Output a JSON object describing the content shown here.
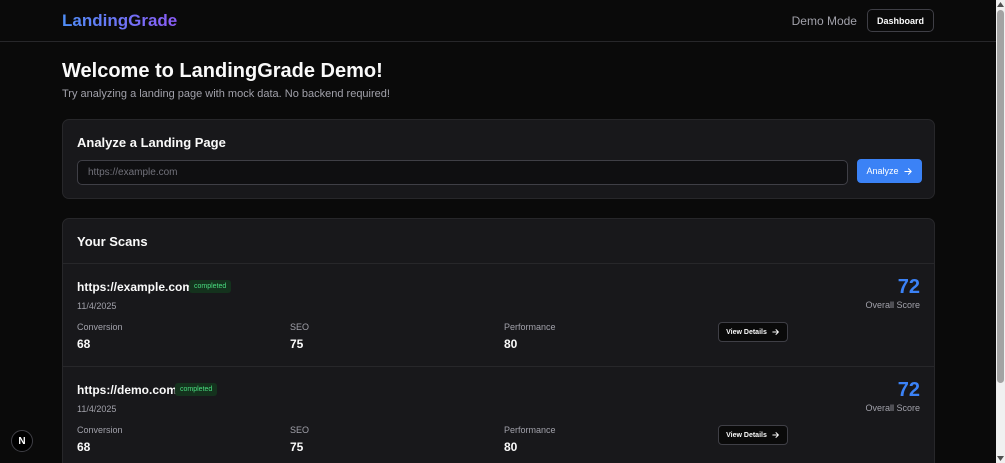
{
  "header": {
    "logo": "LandingGrade",
    "demo_mode": "Demo Mode",
    "dashboard_button": "Dashboard"
  },
  "hero": {
    "title": "Welcome to LandingGrade Demo!",
    "subtitle": "Try analyzing a landing page with mock data. No backend required!"
  },
  "analyze": {
    "title": "Analyze a Landing Page",
    "input_placeholder": "https://example.com",
    "input_value": "",
    "button_label": "Analyze"
  },
  "scans": {
    "title": "Your Scans",
    "items": [
      {
        "url": "https://example.com",
        "status": "completed",
        "date": "11/4/2025",
        "score": "72",
        "score_label": "Overall Score",
        "metrics": [
          {
            "label": "Conversion",
            "value": "68"
          },
          {
            "label": "SEO",
            "value": "75"
          },
          {
            "label": "Performance",
            "value": "80"
          }
        ],
        "details_button": "View Details"
      },
      {
        "url": "https://demo.com",
        "status": "completed",
        "date": "11/4/2025",
        "score": "72",
        "score_label": "Overall Score",
        "metrics": [
          {
            "label": "Conversion",
            "value": "68"
          },
          {
            "label": "SEO",
            "value": "75"
          },
          {
            "label": "Performance",
            "value": "80"
          }
        ],
        "details_button": "View Details"
      }
    ]
  },
  "next_badge": "N",
  "colors": {
    "background": "#0a0a0a",
    "card": "#18181b",
    "accent": "#3b82f6",
    "badge_text": "#4ade80",
    "badge_bg": "#14321d"
  },
  "icons": {
    "analyze_arrow": "arrow-right-icon",
    "details_arrow": "arrow-right-icon"
  }
}
